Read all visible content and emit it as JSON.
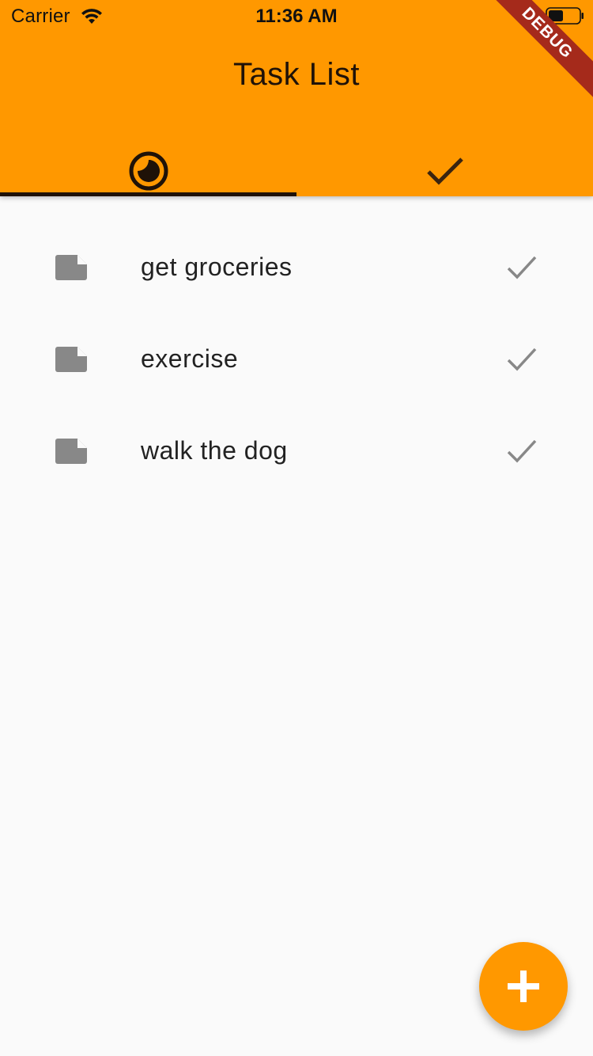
{
  "status_bar": {
    "carrier": "Carrier",
    "time": "11:36 AM"
  },
  "app_bar": {
    "title": "Task List",
    "background_color": "#FF9800",
    "tabs": [
      {
        "icon": "clock-pie-icon",
        "selected": true
      },
      {
        "icon": "check-icon",
        "selected": false
      }
    ]
  },
  "debug_banner": "DEBUG",
  "tasks": [
    {
      "label": "get groceries",
      "icon": "note-icon",
      "action_icon": "check-icon"
    },
    {
      "label": "exercise",
      "icon": "note-icon",
      "action_icon": "check-icon"
    },
    {
      "label": "walk the dog",
      "icon": "note-icon",
      "action_icon": "check-icon"
    }
  ],
  "fab": {
    "icon": "add-icon",
    "color": "#FF9800"
  }
}
